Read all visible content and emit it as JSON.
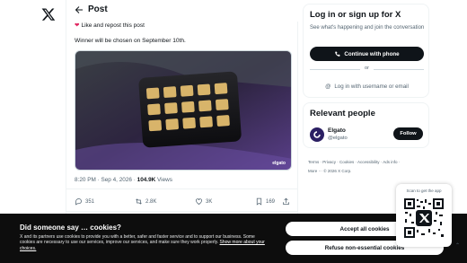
{
  "nav": {
    "logo_icon": "x-logo-icon"
  },
  "header": {
    "back_icon": "arrow-left-icon",
    "title": "Post"
  },
  "post": {
    "notice_icon": "heart-icon",
    "notice": "Like and repost this post",
    "text": "Winner will be chosen on September 10th.",
    "media_caption": "elgato",
    "time": "8:20 PM · Sep 4, 2026 · ",
    "views_count": "104.9K",
    "views_label": " Views",
    "actions": {
      "replies": "351",
      "reposts": "2.8K",
      "likes": "3K",
      "bookmarks": "169"
    }
  },
  "signup": {
    "title": "Log in or sign up for X",
    "description": "See what's happening and join the conversation",
    "phone_button": "Continue with phone",
    "or": "or",
    "login_button": "Log in with username or email"
  },
  "relevant": {
    "title": "Relevant people",
    "account_name": "Elgato",
    "account_handle": "@elgato",
    "follow_button": "Follow"
  },
  "footer": {
    "line1": "Terms · Privacy · Cookies · Accessibility · Ads info ·",
    "line2": "More ··· © 2026 X Corp."
  },
  "cookie": {
    "title": "Did someone say … cookies?",
    "body": "X and its partners use cookies to provide you with a better, safer and faster service and to support our business. Some cookies are necessary to use our services, improve our services, and make sure they work properly.",
    "link": "Show more about your choices.",
    "accept_button": "Accept all cookies",
    "refuse_button": "Refuse non-essential cookies"
  },
  "qr": {
    "label": "Scan to get the app"
  },
  "colors": {
    "accent": "#0f1419",
    "background": "#ffffff",
    "muted": "#536471",
    "banner": "#0d0d0d"
  }
}
